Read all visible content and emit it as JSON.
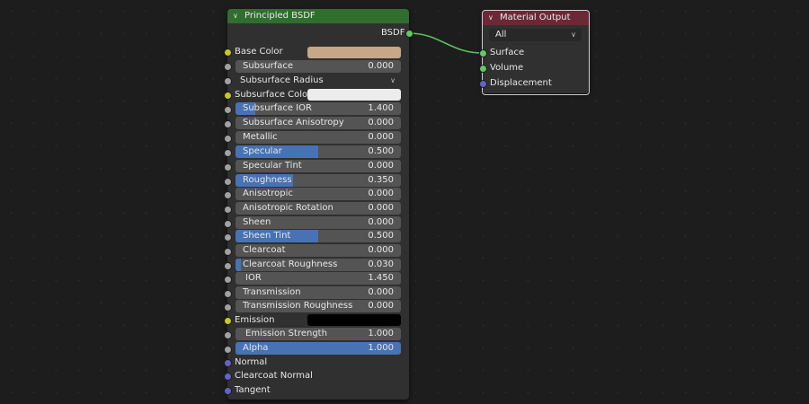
{
  "colors": {
    "bsdf_header": "#2f6e2f",
    "output_header": "#6b2937",
    "base_color": "#c7a787",
    "subsurface_color": "#ececec",
    "emission": "#000000",
    "slider": "#4772b3",
    "link": "#5cbf5c"
  },
  "bsdf": {
    "title": "Principled BSDF",
    "output_label": "BSDF",
    "base_color_label": "Base Color",
    "subsurface": {
      "label": "Subsurface",
      "value": "0.000"
    },
    "subsurface_method": "Subsurface Radius",
    "subsurface_color_label": "Subsurface Color",
    "subsurface_ior": {
      "label": "Subsurface IOR",
      "value": "1.400",
      "fill": 0.12
    },
    "subsurface_anisotropy": {
      "label": "Subsurface Anisotropy",
      "value": "0.000"
    },
    "metallic": {
      "label": "Metallic",
      "value": "0.000"
    },
    "specular": {
      "label": "Specular",
      "value": "0.500",
      "fill": 0.5
    },
    "specular_tint": {
      "label": "Specular Tint",
      "value": "0.000"
    },
    "roughness": {
      "label": "Roughness",
      "value": "0.350",
      "fill": 0.35
    },
    "anisotropic": {
      "label": "Anisotropic",
      "value": "0.000"
    },
    "anisotropic_rotation": {
      "label": "Anisotropic Rotation",
      "value": "0.000"
    },
    "sheen": {
      "label": "Sheen",
      "value": "0.000"
    },
    "sheen_tint": {
      "label": "Sheen Tint",
      "value": "0.500",
      "fill": 0.5
    },
    "clearcoat": {
      "label": "Clearcoat",
      "value": "0.000"
    },
    "clearcoat_roughness": {
      "label": "Clearcoat Roughness",
      "value": "0.030",
      "fill": 0.03
    },
    "ior": {
      "label": "IOR",
      "value": "1.450"
    },
    "transmission": {
      "label": "Transmission",
      "value": "0.000"
    },
    "transmission_roughness": {
      "label": "Transmission Roughness",
      "value": "0.000"
    },
    "emission_label": "Emission",
    "emission_strength": {
      "label": "Emission Strength",
      "value": "1.000"
    },
    "alpha": {
      "label": "Alpha",
      "value": "1.000",
      "fill": 1.0
    },
    "normal_label": "Normal",
    "clearcoat_normal_label": "Clearcoat Normal",
    "tangent_label": "Tangent"
  },
  "output": {
    "title": "Material Output",
    "target": "All",
    "surface_label": "Surface",
    "volume_label": "Volume",
    "displacement_label": "Displacement"
  }
}
